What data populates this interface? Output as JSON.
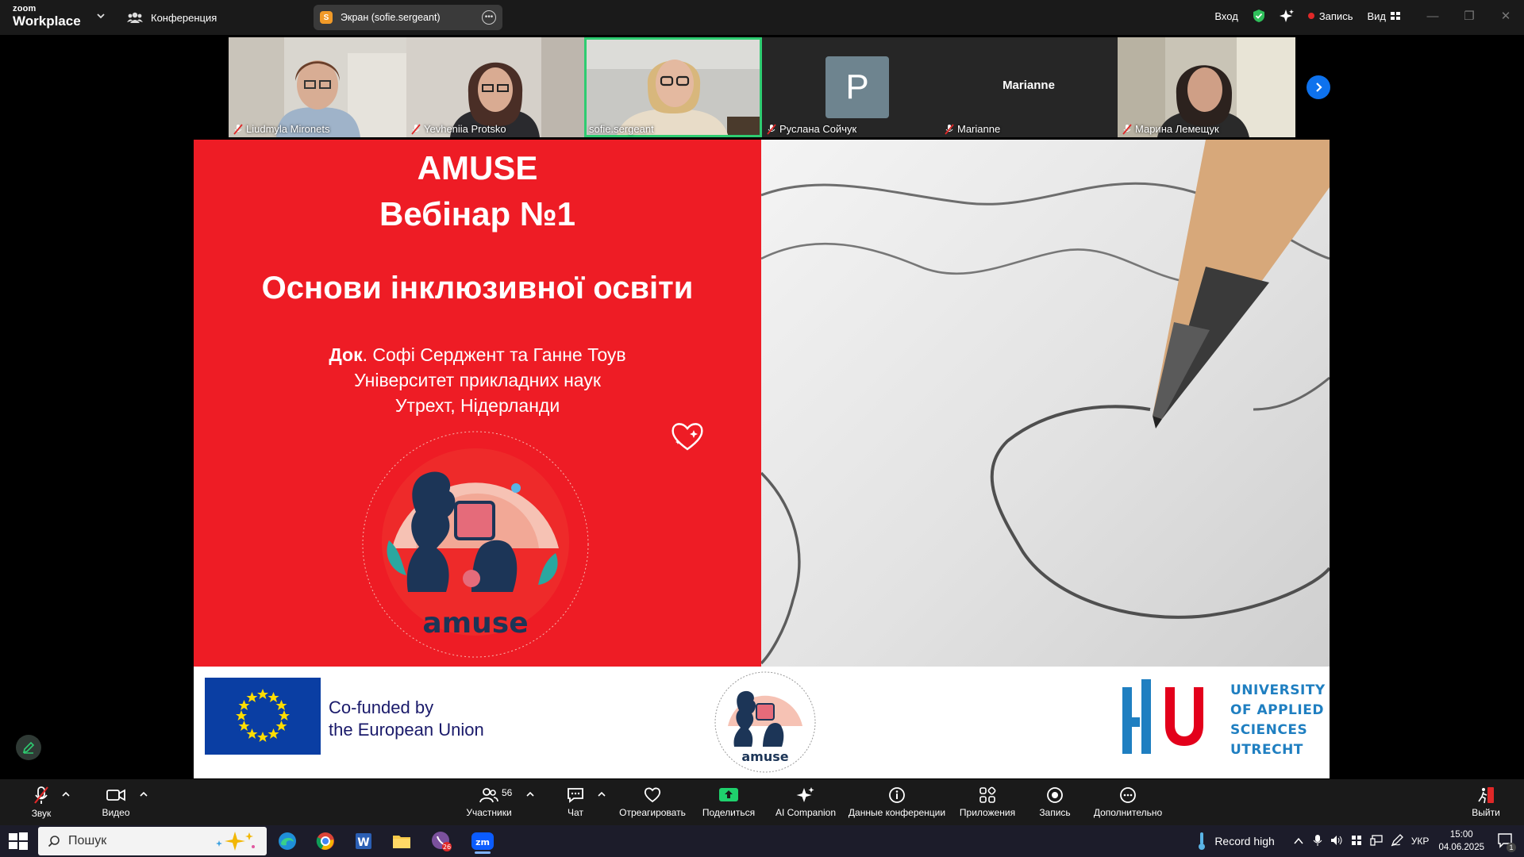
{
  "app": {
    "logo_top": "zoom",
    "logo_bottom": "Workplace",
    "meeting_label": "Конференция",
    "screen_share_badge": "S",
    "screen_share_label": "Экран (sofie.sergeant)",
    "signin_label": "Вход",
    "record_label": "Запись",
    "view_label": "Вид"
  },
  "participants": [
    {
      "name": "Liudmyla Mironets",
      "muted": true,
      "kind": "video"
    },
    {
      "name": "Yevheniia Protsko",
      "muted": true,
      "kind": "video"
    },
    {
      "name": "sofie.sergeant",
      "muted": false,
      "kind": "video",
      "active": true
    },
    {
      "name": "Руслана Сойчук",
      "muted": true,
      "kind": "avatar",
      "initial": "P"
    },
    {
      "name": "Marianne",
      "muted": true,
      "kind": "name",
      "display": "Marianne"
    },
    {
      "name": "Марина Лемещук",
      "muted": true,
      "kind": "video"
    }
  ],
  "slide": {
    "title1": "AMUSE",
    "title2": "Вебінар №1",
    "title3": "Основи інклюзивної освіти",
    "author_prefix": "Док",
    "author_rest": ". Софі Серджент та Ганне Тоув",
    "line2": "Університет прикладних наук",
    "line3": "Утрехт, Нідерланди",
    "logo_word": "amuse",
    "eu_line1": "Co-funded by",
    "eu_line2": "the European Union",
    "hu_lines": [
      "UNIVERSITY",
      "OF APPLIED",
      "SCIENCES",
      "UTRECHT"
    ],
    "colors": {
      "red": "#ee1c25",
      "eu_blue": "#0a3ea3",
      "hu_blue": "#1f7fc1"
    }
  },
  "toolbar": {
    "audio": "Звук",
    "video": "Видео",
    "participants": "Участники",
    "participants_count": "56",
    "chat": "Чат",
    "react": "Отреагировать",
    "share": "Поделиться",
    "ai": "AI Companion",
    "info": "Данные конференции",
    "apps": "Приложения",
    "record": "Запись",
    "more": "Дополнительно",
    "leave": "Выйти"
  },
  "taskbar": {
    "search_placeholder": "Пошук",
    "chrome_badge": "26",
    "weather": "Record high",
    "lang": "УКР",
    "time": "15:00",
    "date": "04.06.2025",
    "notif_count": "1"
  }
}
